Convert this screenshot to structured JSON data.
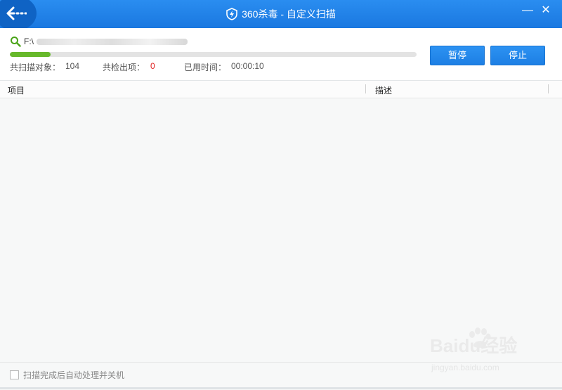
{
  "window": {
    "title": "360杀毒 - 自定义扫描",
    "minimize_glyph": "—",
    "close_glyph": "✕"
  },
  "scan": {
    "path": "F:\\",
    "progress": 0.1,
    "stats": {
      "objects_label": "共扫描对象：",
      "objects_value": "104",
      "found_label": "共检出项：",
      "found_value": "0",
      "time_label": "已用时间：",
      "time_value": "00:00:10"
    },
    "pause_label": "暂停",
    "stop_label": "停止"
  },
  "table": {
    "columns": [
      "项目",
      "描述"
    ],
    "rows": []
  },
  "footer": {
    "checkbox_label": "扫描完成后自动处理并关机",
    "checked": false
  },
  "watermark": {
    "main": "Baidu经验",
    "sub": "jingyan.baidu.com"
  },
  "colors": {
    "titlebar": "#1a78e0",
    "button": "#1d7fe4",
    "progress": "#66b82a",
    "found_value": "#e02020"
  }
}
